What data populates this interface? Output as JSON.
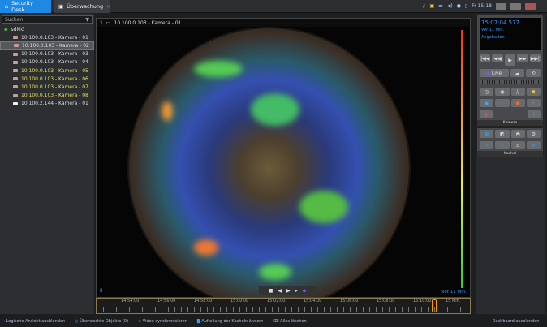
{
  "tabs": [
    {
      "label": "Security Desk"
    },
    {
      "label": "Überwachung"
    }
  ],
  "tray": {
    "clock": "Fr 15:18"
  },
  "sidebar": {
    "search_placeholder": "Suchen",
    "root": "sdMG",
    "items": [
      {
        "label": "10.100.0.103 - Kamera - 01",
        "highlight": false
      },
      {
        "label": "10.100.0.103 - Kamera - 02",
        "highlight": false
      },
      {
        "label": "10.100.0.103 - Kamera - 03",
        "highlight": false
      },
      {
        "label": "10.100.0.103 - Kamera - 04",
        "highlight": false
      },
      {
        "label": "10.100.0.103 - Kamera - 05",
        "highlight": true
      },
      {
        "label": "10.100.0.103 - Kamera - 06",
        "highlight": true
      },
      {
        "label": "10.100.0.103 - Kamera - 07",
        "highlight": true
      },
      {
        "label": "10.100.0.103 - Kamera - 08",
        "highlight": true
      },
      {
        "label": "10.100.2.144 - Kamera - 01",
        "highlight": false
      }
    ]
  },
  "video": {
    "tile_number": "1",
    "title": "10.100.0.103 - Kamera - 01",
    "age": "Vor 11 Min.",
    "pause": "II"
  },
  "timeline": {
    "labels": [
      "14:54:00",
      "14:56:00",
      "14:58:00",
      "15:00:00",
      "15:02:00",
      "15:04:00",
      "15:06:00",
      "15:08:00",
      "15:10:00",
      "15 Min."
    ]
  },
  "dashboard": {
    "time": "15:07:04.577",
    "age": "Vor 11 Min.",
    "status": "Angehalten",
    "live": "Live",
    "camera_label": "Kamera",
    "tile_label": "Kachel"
  },
  "bottombar": {
    "hide_logical": "Logische Ansicht ausblenden",
    "monitored": "Überwachte Objekte (0)",
    "sync": "Video synchronisieren",
    "layout": "Aufteilung der Kacheln ändern",
    "clear": "Alles löschen",
    "hide_dashboard": "Dashboard ausblenden"
  }
}
